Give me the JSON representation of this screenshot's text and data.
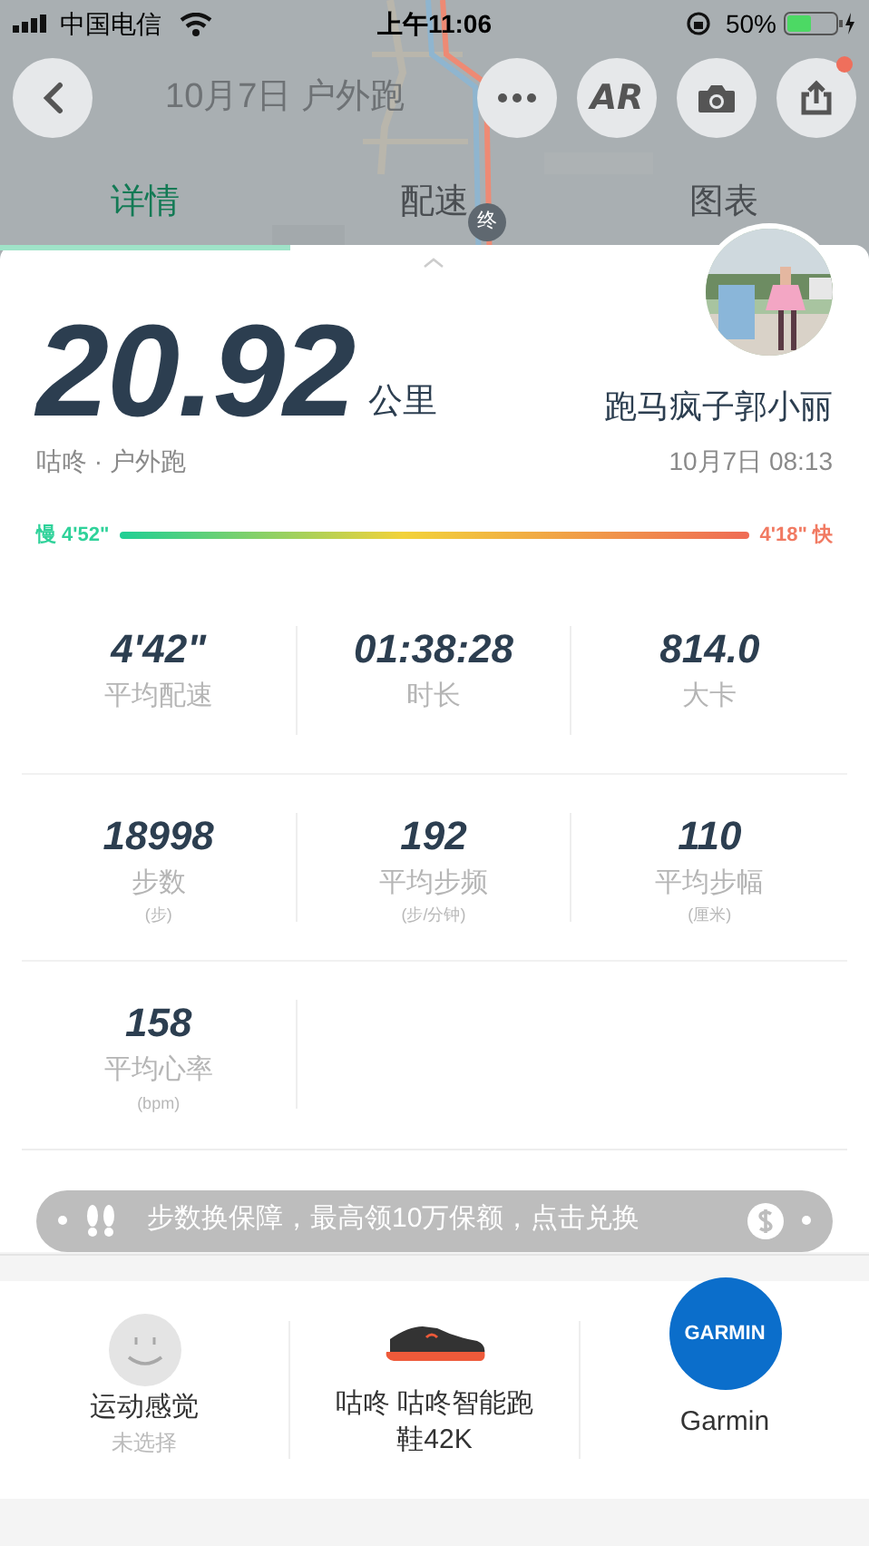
{
  "status_bar": {
    "carrier": "中国电信",
    "time": "上午11:06",
    "battery": "50%"
  },
  "header": {
    "title": "10月7日 户外跑",
    "ar_button": "AR",
    "share_badge": true
  },
  "tabs": [
    {
      "label": "详情",
      "selected": true
    },
    {
      "label": "配速",
      "selected": false
    },
    {
      "label": "图表",
      "selected": false
    }
  ],
  "map": {
    "kind": "picture",
    "end_marker": "终"
  },
  "summary": {
    "distance": "20.92",
    "unit": "公里",
    "source": "咕咚 · 户外跑",
    "user": "跑马疯子郭小丽",
    "date": "10月7日 08:13"
  },
  "pace_range": {
    "slow": "慢 4'52\"",
    "fast": "4'18\" 快"
  },
  "stats": [
    {
      "value": "4'42\"",
      "label": "平均配速"
    },
    {
      "value": "01:38:28",
      "label": "时长"
    },
    {
      "value": "814.0",
      "label": "大卡"
    },
    {
      "value": "18998",
      "label": "步数",
      "unit": "(步)"
    },
    {
      "value": "192",
      "label": "平均步频",
      "unit": "(步/分钟)"
    },
    {
      "value": "110",
      "label": "平均步幅",
      "unit": "(厘米)"
    },
    {
      "value": "158",
      "label": "平均心率",
      "unit": "(bpm)"
    }
  ],
  "banner": {
    "text": "步数换保障，最高领10万保额，点击兑换"
  },
  "tiles": [
    {
      "kind": "feeling",
      "title": "运动感觉",
      "subtitle": "未选择"
    },
    {
      "kind": "shoe",
      "title": "咕咚 咕咚智能跑鞋42K"
    },
    {
      "kind": "device",
      "logo": "GARMIN",
      "title": "Garmin"
    }
  ]
}
